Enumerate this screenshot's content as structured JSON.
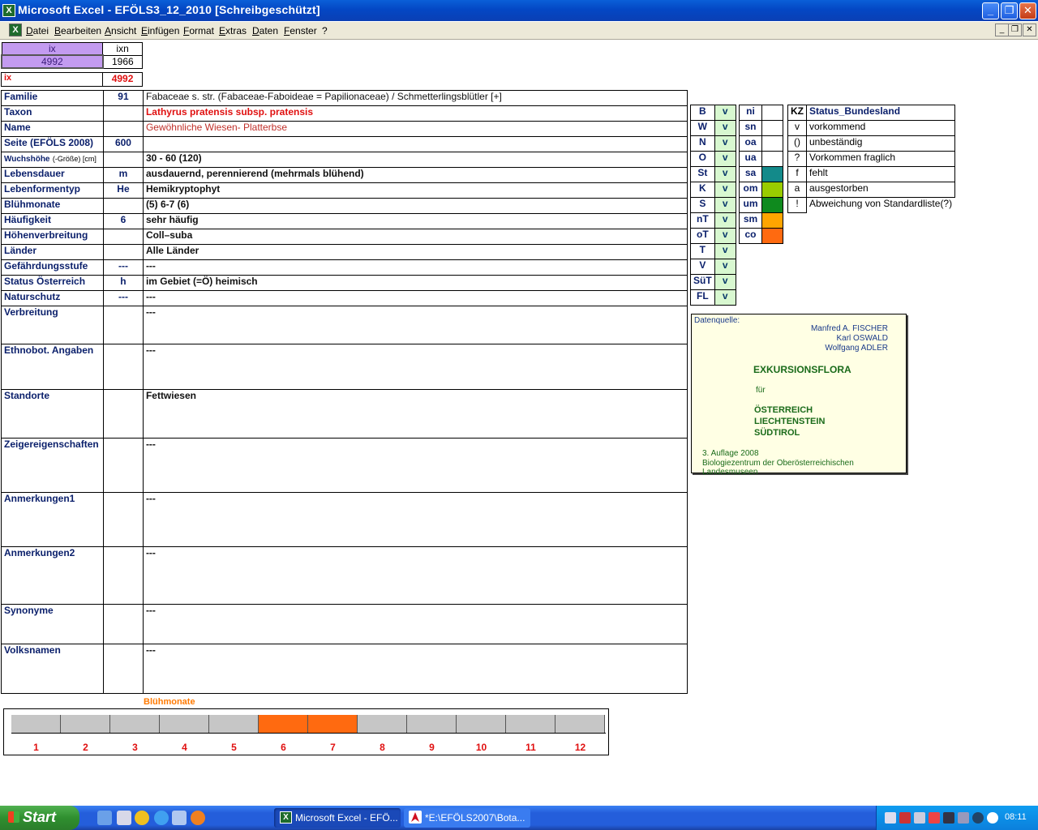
{
  "window": {
    "title": "Microsoft Excel - EFÖLS3_12_2010  [Schreibgeschützt]",
    "minimize": "_",
    "restore": "❐",
    "close": "✕"
  },
  "menu": [
    "Datei",
    "Bearbeiten",
    "Ansicht",
    "Einfügen",
    "Format",
    "Extras",
    "Daten",
    "Fenster",
    "?"
  ],
  "mdi": {
    "min": "_",
    "restore": "❐",
    "close": "✕"
  },
  "top_mini": {
    "h1": "ix",
    "h2": "ixn",
    "v1": "4992",
    "v2": "1966"
  },
  "ix": {
    "label": "ix",
    "value": "4992"
  },
  "fields": [
    {
      "label": "Familie",
      "code": "91",
      "value": "Fabaceae s. str. (Fabaceae-Faboideae = Papilionaceae)  /  Schmetterlingsblütler [+]"
    },
    {
      "label": "Taxon",
      "code": "",
      "value": "Lathyrus pratensis subsp. pratensis"
    },
    {
      "label": "Name",
      "code": "",
      "value": "Gewöhnliche Wiesen- Platterbse"
    },
    {
      "label": "Seite (EFÖLS 2008)",
      "code": "600",
      "value": ""
    },
    {
      "label": "Wuchshöhe",
      "label_small": "(-Größe) [cm]",
      "code": "",
      "value": " 30 - 60 (120)"
    },
    {
      "label": "Lebensdauer",
      "code": "m",
      "value": "ausdauernd, perennierend (mehrmals blühend)"
    },
    {
      "label": "Lebenformentyp",
      "code": "He",
      "value": "Hemikryptophyt"
    },
    {
      "label": "Blühmonate",
      "code": "",
      "value": "(5) 6-7 (6)"
    },
    {
      "label": "Häufigkeit",
      "code": "6",
      "value": "sehr häufig"
    },
    {
      "label": "Höhenverbreitung",
      "code": "",
      "value": "Coll–suba"
    },
    {
      "label": "Länder",
      "code": "",
      "value": "Alle Länder"
    },
    {
      "label": "Gefährdungsstufe",
      "code": "---",
      "value": "  ---"
    },
    {
      "label": "Status Österreich",
      "code": "h",
      "value": "im Gebiet (=Ö) heimisch"
    },
    {
      "label": "Naturschutz",
      "code": "---",
      "value": "---"
    },
    {
      "label": "Verbreitung",
      "code": "",
      "value": "---"
    },
    {
      "label": "Ethnobot. Angaben",
      "code": "",
      "value": "---"
    },
    {
      "label": "Standorte",
      "code": "",
      "value": "Fettwiesen"
    },
    {
      "label": "Zeigereigenschaften",
      "code": "",
      "value": "---"
    },
    {
      "label": "Anmerkungen1",
      "code": "",
      "value": "---"
    },
    {
      "label": "Anmerkungen2",
      "code": "",
      "value": "---"
    },
    {
      "label": "Synonyme",
      "code": "",
      "value": "---"
    },
    {
      "label": "Volksnamen",
      "code": "",
      "value": "---"
    }
  ],
  "bundeslaender": [
    {
      "code": "B",
      "status": "v"
    },
    {
      "code": "W",
      "status": "v"
    },
    {
      "code": "N",
      "status": "v"
    },
    {
      "code": "O",
      "status": "v"
    },
    {
      "code": "St",
      "status": "v"
    },
    {
      "code": "K",
      "status": "v"
    },
    {
      "code": "S",
      "status": "v"
    },
    {
      "code": "nT",
      "status": "v"
    },
    {
      "code": "oT",
      "status": "v"
    },
    {
      "code": "T",
      "status": "v"
    },
    {
      "code": "V",
      "status": "v"
    },
    {
      "code": "SüT",
      "status": "v"
    },
    {
      "code": "FL",
      "status": "v"
    }
  ],
  "hoehenstufen": [
    {
      "code": "ni",
      "color": ""
    },
    {
      "code": "sn",
      "color": ""
    },
    {
      "code": "oa",
      "color": ""
    },
    {
      "code": "ua",
      "color": ""
    },
    {
      "code": "sa",
      "color": "#138a8a"
    },
    {
      "code": "om",
      "color": "#99cc00"
    },
    {
      "code": "um",
      "color": "#0f8a1e"
    },
    {
      "code": "sm",
      "color": "#ffa500"
    },
    {
      "code": "co",
      "color": "#ff6a10"
    }
  ],
  "legend": {
    "kz": "KZ",
    "title": "Status_Bundesland",
    "rows": [
      {
        "k": "v",
        "t": "vorkommend"
      },
      {
        "k": "()",
        "t": "unbeständig"
      },
      {
        "k": "?",
        "t": "Vorkommen fraglich"
      },
      {
        "k": "f",
        "t": "fehlt"
      },
      {
        "k": "a",
        "t": "ausgestorben"
      },
      {
        "k": "!",
        "t": "Abweichung von Standardliste(?)"
      }
    ]
  },
  "source": {
    "label": "Datenquelle:",
    "authors": [
      "Manfred A. FISCHER",
      "Karl OSWALD",
      "Wolfgang ADLER"
    ],
    "title": "EXKURSIONSFLORA",
    "fuer": "für",
    "countries": [
      "ÖSTERREICH",
      "LIECHTENSTEIN",
      "SÜDTIROL"
    ],
    "edition": "3. Auflage 2008",
    "publisher": "Biologiezentrum der Oberösterreichischen Landesmuseen"
  },
  "bluehmonate": {
    "title": "Blühmonate",
    "months": [
      "1",
      "2",
      "3",
      "4",
      "5",
      "6",
      "7",
      "8",
      "9",
      "10",
      "11",
      "12"
    ],
    "active": [
      6,
      7
    ],
    "active_color": "#ff6a10",
    "inactive_color": "#c6c6c6"
  },
  "taskbar": {
    "start": "Start",
    "tasks": [
      "Microsoft Excel - EFÖ...",
      "*E:\\EFÖLS2007\\Bota..."
    ],
    "clock": "08:11"
  }
}
